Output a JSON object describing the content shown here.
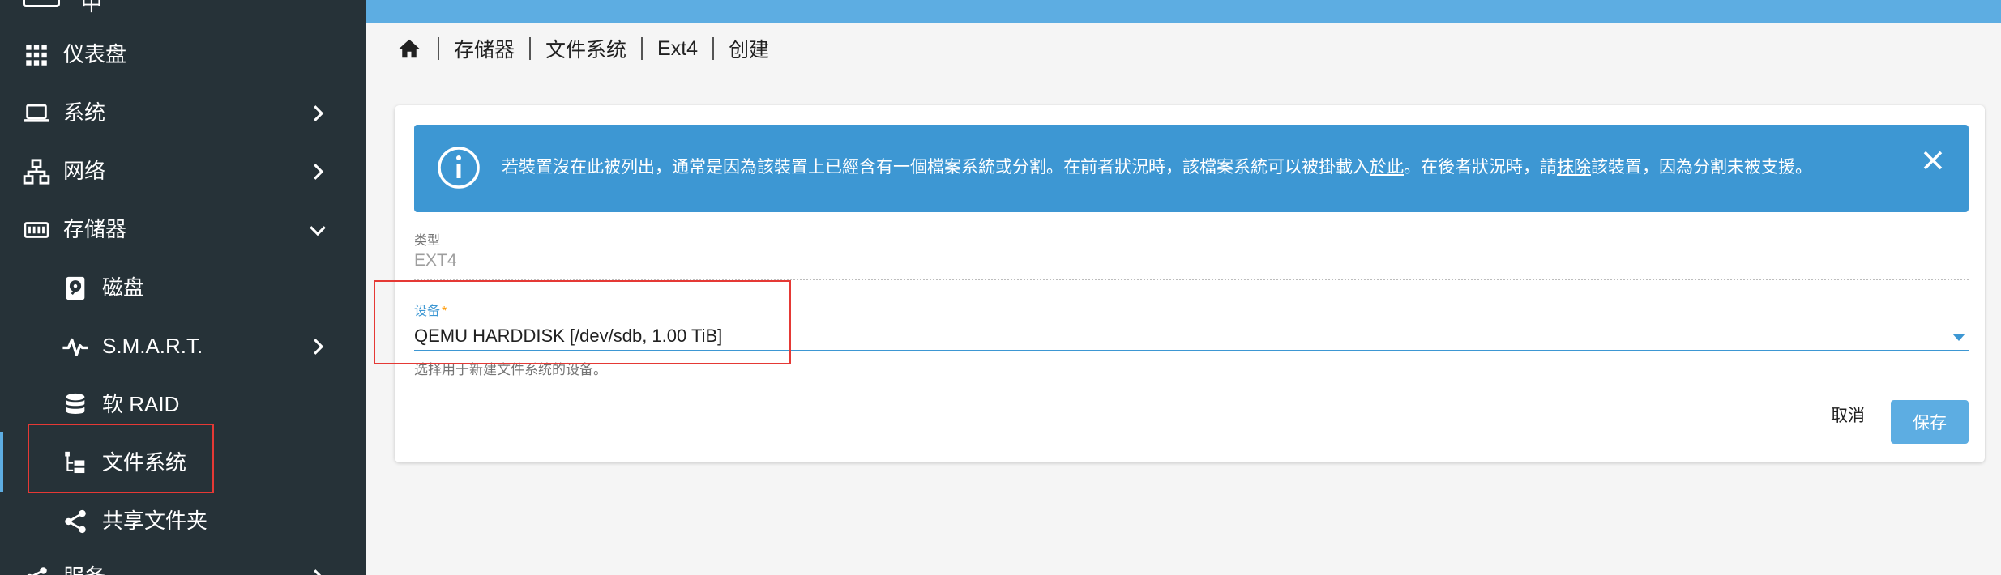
{
  "sidebar": {
    "top_partial_label": "中",
    "items": [
      {
        "label": "仪表盘",
        "icon": "grid-icon"
      },
      {
        "label": "系统",
        "icon": "laptop-icon"
      },
      {
        "label": "网络",
        "icon": "network-icon"
      },
      {
        "label": "存储器",
        "icon": "storage-icon"
      },
      {
        "label": "磁盘",
        "icon": "disk-icon"
      },
      {
        "label": "S.M.A.R.T.",
        "icon": "pulse-icon"
      },
      {
        "label": "软 RAID",
        "icon": "database-icon"
      },
      {
        "label": "文件系统",
        "icon": "filesystem-tree-icon"
      },
      {
        "label": "共享文件夹",
        "icon": "share-icon"
      },
      {
        "label": "服务",
        "icon": "services-icon"
      }
    ]
  },
  "colors": {
    "sidebar_bg": "#263238",
    "accent": "#5dade2",
    "alert_bg": "#3d97d3",
    "highlight_border": "#e53935"
  },
  "breadcrumb": {
    "home_icon": "home-icon",
    "items": [
      "存储器",
      "文件系统",
      "Ext4",
      "创建"
    ]
  },
  "alert": {
    "icon": "info-icon",
    "text_part1": "若裝置沒在此被列出，通常是因為該裝置上已經含有一個檔案系統或分割。在前者狀況時，該檔案系統可以被掛載入",
    "link1": "於此",
    "text_part2": "。在後者狀況時，請",
    "link2": "抹除",
    "text_part3": "該裝置，因為分割未被支援。",
    "close_icon": "close-icon"
  },
  "form": {
    "type_label": "类型",
    "type_value": "EXT4",
    "device_label": "设备",
    "device_required_mark": "*",
    "device_value": "QEMU HARDDISK [/dev/sdb, 1.00 TiB]",
    "device_hint": "选择用于新建文件系统的设备。"
  },
  "buttons": {
    "cancel": "取消",
    "save": "保存"
  }
}
